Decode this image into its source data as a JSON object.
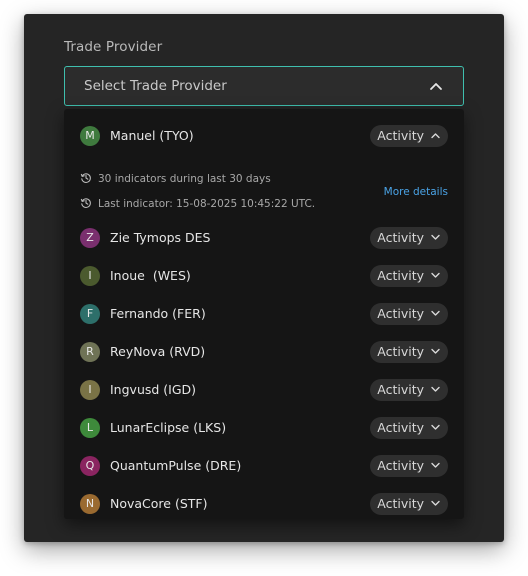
{
  "field": {
    "label": "Trade Provider",
    "placeholder": "Select Trade Provider"
  },
  "expanded": {
    "initial": "M",
    "color": "#3f7a3e",
    "name": "Manuel (TYO)",
    "activity_label": "Activity",
    "indicators_text": "30 indicators during last 30 days",
    "last_indicator_text": "Last indicator: 15-08-2025 10:45:22 UTC.",
    "more_details_label": "More details"
  },
  "providers": [
    {
      "initial": "Z",
      "color": "#7a2f6e",
      "name": "Zie Tymops DES",
      "activity_label": "Activity"
    },
    {
      "initial": "I",
      "color": "#4b5a2e",
      "name": "Inoue  (WES)",
      "activity_label": "Activity"
    },
    {
      "initial": "F",
      "color": "#2d6f6a",
      "name": "Fernando (FER)",
      "activity_label": "Activity"
    },
    {
      "initial": "R",
      "color": "#6f7356",
      "name": "ReyNova (RVD)",
      "activity_label": "Activity"
    },
    {
      "initial": "I",
      "color": "#7a7346",
      "name": "Ingvusd (IGD)",
      "activity_label": "Activity"
    },
    {
      "initial": "L",
      "color": "#3e8a3b",
      "name": "LunarEclipse (LKS)",
      "activity_label": "Activity"
    },
    {
      "initial": "Q",
      "color": "#8a2460",
      "name": "QuantumPulse (DRE)",
      "activity_label": "Activity"
    },
    {
      "initial": "N",
      "color": "#9a6a30",
      "name": "NovaCore (STF)",
      "activity_label": "Activity"
    }
  ],
  "colors": {
    "accent_border": "#3fbfae",
    "link": "#4aa3e6"
  }
}
